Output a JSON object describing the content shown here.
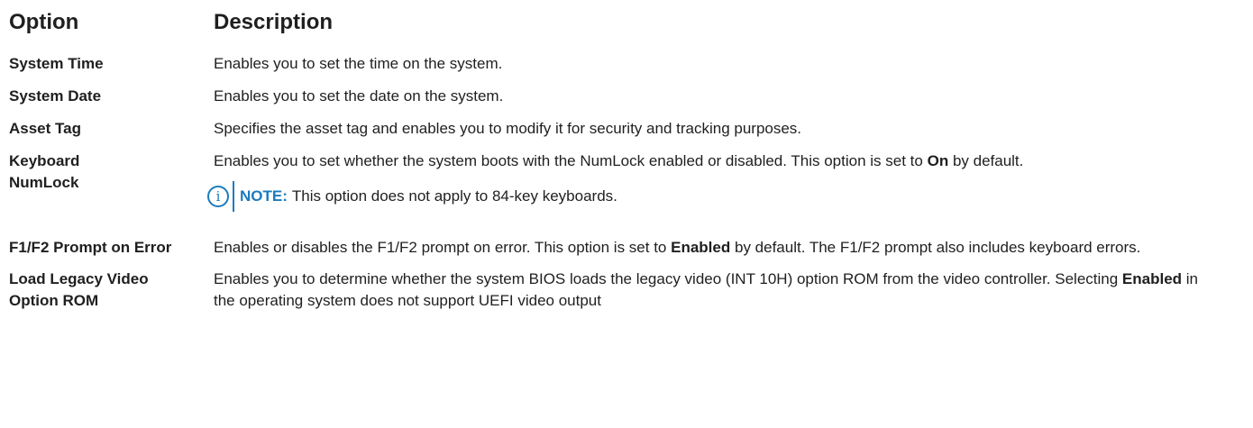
{
  "header": {
    "option": "Option",
    "description": "Description"
  },
  "rows": [
    {
      "option": "System Time",
      "description": "Enables you to set the time on the system."
    },
    {
      "option": "System Date",
      "description": "Enables you to set the date on the system."
    },
    {
      "option": "Asset Tag",
      "description": "Specifies the asset tag and enables you to modify it for security and tracking purposes."
    },
    {
      "option": "Keyboard NumLock",
      "description_pre": "Enables you to set whether the system boots with the NumLock enabled or disabled. This option is set to",
      "description_bold": "On",
      "description_post": "by default.",
      "note_label": "NOTE:",
      "note_text": "This option does not apply to 84-key keyboards."
    },
    {
      "option": "F1/F2 Prompt on Error",
      "description_pre": "Enables or disables the F1/F2 prompt on error. This option is set to",
      "description_bold": "Enabled",
      "description_post": "by default. The F1/F2 prompt also includes keyboard errors."
    },
    {
      "option": "Load Legacy Video Option ROM",
      "description_pre": "Enables you to determine whether the system BIOS loads the legacy video (INT 10H) option ROM from the video controller. Selecting",
      "description_bold": "Enabled",
      "description_post": "in the operating system does not support UEFI video output"
    }
  ],
  "note_icon_glyph": "i",
  "colors": {
    "text": "#1f1f1f",
    "note_accent": "#1a7bbf"
  }
}
